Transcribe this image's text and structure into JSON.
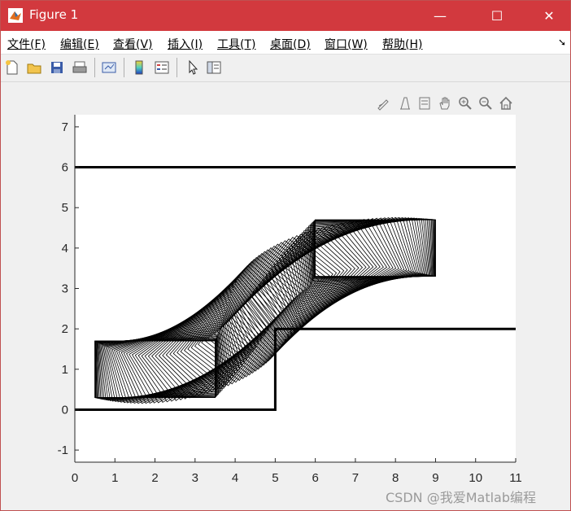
{
  "window": {
    "title": "Figure 1",
    "minimize": "—",
    "maximize": "☐",
    "close": "✕"
  },
  "menu": [
    {
      "label": "文件",
      "key": "(F)"
    },
    {
      "label": "编辑",
      "key": "(E)"
    },
    {
      "label": "查看",
      "key": "(V)"
    },
    {
      "label": "插入",
      "key": "(I)"
    },
    {
      "label": "工具",
      "key": "(T)"
    },
    {
      "label": "桌面",
      "key": "(D)"
    },
    {
      "label": "窗口",
      "key": "(W)"
    },
    {
      "label": "帮助",
      "key": "(H)"
    }
  ],
  "toolbar": [
    "new-figure-icon",
    "open-file-icon",
    "save-icon",
    "print-icon",
    "link-plot-icon",
    "colorbar-icon",
    "legend-icon",
    "pointer-icon",
    "property-editor-icon"
  ],
  "axes_toolbar": [
    "brush-icon",
    "data-tips-icon",
    "rotate-icon",
    "pan-icon",
    "zoom-in-icon",
    "zoom-out-icon",
    "home-icon"
  ],
  "chart_data": {
    "type": "line",
    "xlim": [
      0,
      11
    ],
    "ylim": [
      -1.3,
      7.3
    ],
    "xticks": [
      "0",
      "1",
      "2",
      "3",
      "4",
      "5",
      "6",
      "7",
      "8",
      "9",
      "10",
      "11"
    ],
    "yticks": [
      "-1",
      "0",
      "1",
      "2",
      "3",
      "4",
      "5",
      "6",
      "7"
    ],
    "xtick_values": [
      0,
      1,
      2,
      3,
      4,
      5,
      6,
      7,
      8,
      9,
      10,
      11
    ],
    "ytick_values": [
      -1,
      0,
      1,
      2,
      3,
      4,
      5,
      6,
      7
    ],
    "walls": [
      {
        "name": "upper-boundary",
        "x": [
          0,
          11
        ],
        "y": [
          6,
          6
        ]
      },
      {
        "name": "lower-boundary",
        "x": [
          0,
          5,
          5,
          11
        ],
        "y": [
          0,
          0,
          2,
          2
        ]
      }
    ],
    "rect_start": {
      "x0": 0.5,
      "x1": 3.5,
      "y0": 0.3,
      "y1": 1.7
    },
    "rect_end": {
      "x0": 6.0,
      "x1": 9.0,
      "y0": 3.3,
      "y1": 4.7
    },
    "rect_count": 100,
    "grid": false
  },
  "watermark": "CSDN @我爱Matlab编程"
}
